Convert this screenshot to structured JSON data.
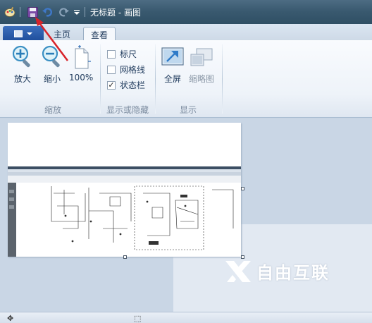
{
  "window": {
    "title": "无标题 - 画图"
  },
  "quick_access": {
    "icons": [
      "paint-app-icon",
      "save-icon",
      "undo-icon",
      "redo-icon",
      "customize-dropdown-icon"
    ]
  },
  "tabs": [
    {
      "label": "主页",
      "active": false
    },
    {
      "label": "查看",
      "active": true
    }
  ],
  "ribbon": {
    "zoom_group": {
      "label": "缩放",
      "zoom_in": "放大",
      "zoom_out": "缩小",
      "actual_size": "100%"
    },
    "show_hide_group": {
      "label": "显示或隐藏",
      "ruler": {
        "label": "标尺",
        "checked": false
      },
      "gridlines": {
        "label": "网格线",
        "checked": false
      },
      "statusbar": {
        "label": "状态栏",
        "checked": true,
        "mark": "✓"
      }
    },
    "display_group": {
      "label": "显示",
      "fullscreen": "全屏",
      "thumbnail": "缩略图"
    }
  },
  "watermark": {
    "text": "自由互联"
  },
  "colors": {
    "accent": "#2a5aa8",
    "titlebar": "#3d5d73",
    "annotation_arrow": "#d8232a"
  }
}
